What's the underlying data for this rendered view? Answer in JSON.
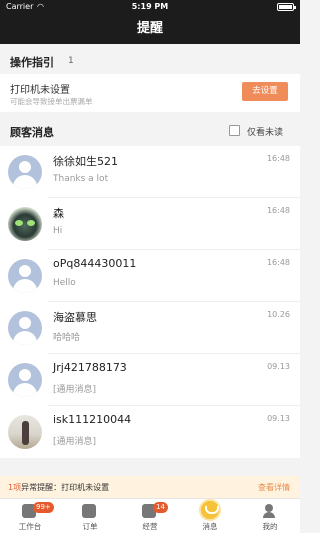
{
  "status_bar": {
    "carrier": "Carrier",
    "wifi_icon": "wifi-icon",
    "time": "5:19 PM"
  },
  "nav": {
    "title": "提醒"
  },
  "guide": {
    "title": "操作指引",
    "count": "1",
    "item_title": "打印机未设置",
    "item_sub": "可能会导致接单出票漏单",
    "button": "去设置"
  },
  "messages_header": {
    "title": "顾客消息",
    "unread_only": "仅看未读"
  },
  "messages": [
    {
      "name": "徐徐如生521",
      "preview": "Thanks a lot",
      "time": "16:48",
      "avatar": "default"
    },
    {
      "name": "森",
      "preview": "Hi",
      "time": "16:48",
      "avatar": "cat"
    },
    {
      "name": "oPq844430011",
      "preview": "Hello",
      "time": "16:48",
      "avatar": "default"
    },
    {
      "name": "海盗慕思",
      "preview": "哈哈哈",
      "time": "10.26",
      "avatar": "default"
    },
    {
      "name": "Jrj421788173",
      "preview": "[通用消息]",
      "time": "09.13",
      "avatar": "default"
    },
    {
      "name": "isk111210044",
      "preview": "[通用消息]",
      "time": "09.13",
      "avatar": "person"
    }
  ],
  "alert": {
    "count": "1项",
    "text": "异常提醒：打印机未设置",
    "link": "查看详情"
  },
  "tabs": [
    {
      "label": "工作台",
      "icon": "workbench-icon",
      "badge": "99+"
    },
    {
      "label": "订单",
      "icon": "order-icon",
      "badge": ""
    },
    {
      "label": "经营",
      "icon": "business-icon",
      "badge": "14"
    },
    {
      "label": "消息",
      "icon": "message-icon",
      "badge": "",
      "active": true
    },
    {
      "label": "我的",
      "icon": "profile-icon",
      "badge": ""
    }
  ]
}
